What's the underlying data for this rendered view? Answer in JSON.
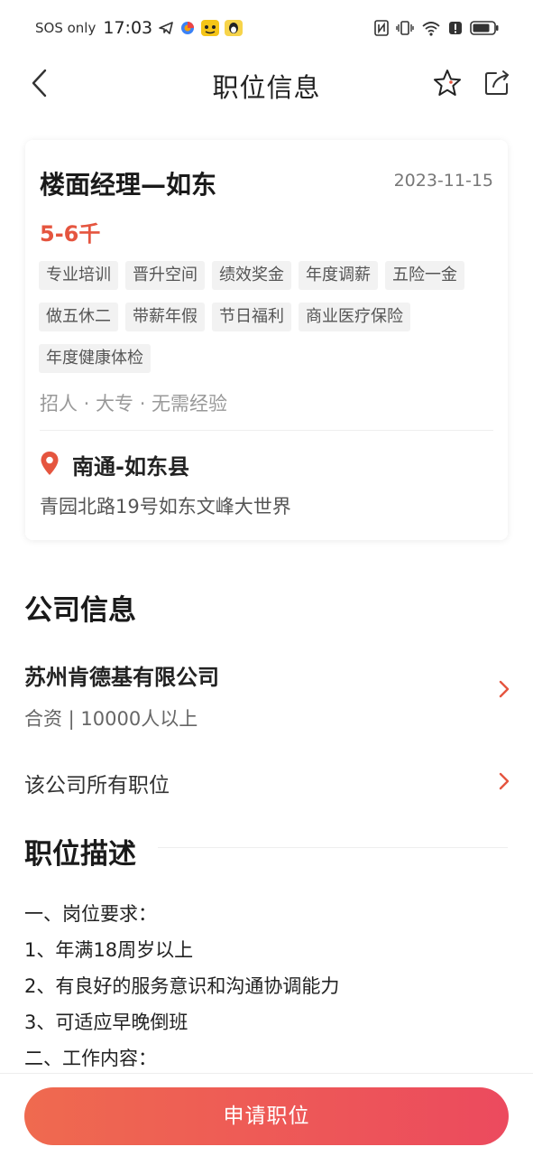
{
  "status_bar": {
    "carrier": "SOS only",
    "time": "17:03"
  },
  "nav": {
    "title": "职位信息"
  },
  "job": {
    "title": "楼面经理—如东",
    "date": "2023-11-15",
    "salary": "5-6千",
    "tags": [
      "专业培训",
      "晋升空间",
      "绩效奖金",
      "年度调薪",
      "五险一金",
      "做五休二",
      "带薪年假",
      "节日福利",
      "商业医疗保险",
      "年度健康体检"
    ],
    "meta": "招人 · 大专 · 无需经验",
    "location_city": "南通-如东县",
    "address": "青园北路19号如东文峰大世界"
  },
  "company_section": {
    "title": "公司信息",
    "name": "苏州肯德基有限公司",
    "meta": "合资 | 10000人以上",
    "all_jobs_label": "该公司所有职位"
  },
  "description": {
    "title": "职位描述",
    "lines": [
      "一、岗位要求：",
      "1、年满18周岁以上",
      "2、有良好的服务意识和沟通协调能力",
      "3、可适应早晚倒班",
      "二、工作内容："
    ]
  },
  "bottom": {
    "apply_label": "申请职位"
  },
  "colors": {
    "accent": "#e5553f",
    "button_start": "#ef6a4f",
    "button_end": "#ec4a5e"
  }
}
